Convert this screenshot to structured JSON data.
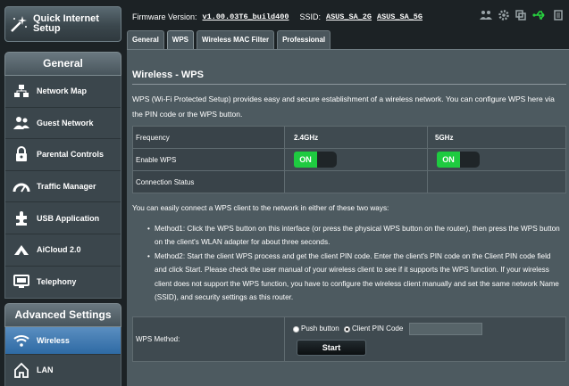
{
  "sidebar": {
    "quick_setup": "Quick Internet Setup",
    "general_header": "General",
    "general_items": [
      {
        "label": "Network Map",
        "icon": "network-map-icon"
      },
      {
        "label": "Guest Network",
        "icon": "guest-network-icon"
      },
      {
        "label": "Parental Controls",
        "icon": "parental-controls-icon"
      },
      {
        "label": "Traffic Manager",
        "icon": "traffic-manager-icon"
      },
      {
        "label": "USB Application",
        "icon": "usb-application-icon"
      },
      {
        "label": "AiCloud 2.0",
        "icon": "aicloud-icon"
      },
      {
        "label": "Telephony",
        "icon": "telephony-icon"
      }
    ],
    "advanced_header": "Advanced Settings",
    "advanced_items": [
      {
        "label": "Wireless",
        "icon": "wireless-icon",
        "active": true
      },
      {
        "label": "LAN",
        "icon": "lan-icon"
      }
    ]
  },
  "topbar": {
    "firmware_label": "Firmware Version:",
    "firmware_value": "v1.00.03T6_build400",
    "ssid_label": "SSID:",
    "ssid_1": "ASUS_SA_2G",
    "ssid_2": "ASUS_SA_5G"
  },
  "tabs": [
    "General",
    "WPS",
    "Wireless MAC Filter",
    "Professional"
  ],
  "selected_tab": "WPS",
  "page": {
    "title": "Wireless - WPS",
    "description": "WPS (Wi-Fi Protected Setup) provides easy and secure establishment of a wireless network. You can configure WPS here via the PIN code or the WPS button."
  },
  "table": {
    "frequency_label": "Frequency",
    "freq_24": "2.4GHz",
    "freq_5": "5GHz",
    "enable_label": "Enable WPS",
    "toggle_24": "ON",
    "toggle_5": "ON",
    "status_label": "Connection Status"
  },
  "info": {
    "intro": "You can easily connect a WPS client to the network in either of these two ways:",
    "method1": "Method1: Click the WPS button on this interface (or press the physical WPS button on the router), then press the WPS button on the client's WLAN adapter for about three seconds.",
    "method2": "Method2: Start the client WPS process and get the client PIN code. Enter the client's PIN code on the Client PIN code field and click Start. Please check the user manual of your wireless client to see if it supports the WPS function. If your wireless client does not support the WPS function, you have to configure the wireless client manually and set the same network Name (SSID), and security settings as this router."
  },
  "method": {
    "label": "WPS Method:",
    "radio_push": "Push button",
    "radio_pin": "Client PIN Code",
    "pin_value": "",
    "start": "Start"
  },
  "colors": {
    "accent_blue": "#2e6aa4",
    "toggle_green": "#1ecb40",
    "usb_icon_green": "#27d13f"
  }
}
